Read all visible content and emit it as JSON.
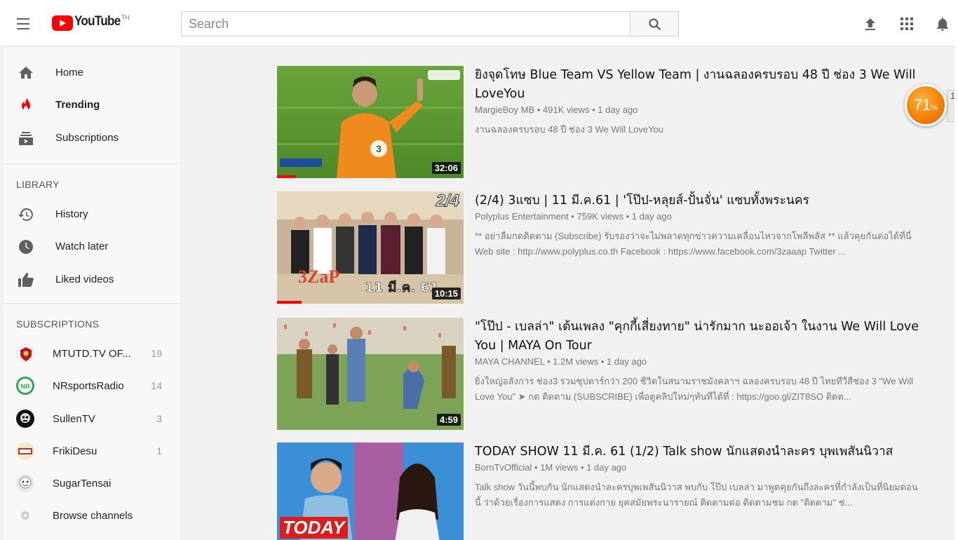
{
  "header": {
    "logo_text": "YouTube",
    "logo_country": "TH",
    "search_placeholder": "Search"
  },
  "sidebar": {
    "main": [
      {
        "label": "Home",
        "icon": "home-icon"
      },
      {
        "label": "Trending",
        "icon": "flame-icon",
        "active": true
      },
      {
        "label": "Subscriptions",
        "icon": "subscriptions-icon"
      }
    ],
    "library_title": "LIBRARY",
    "library": [
      {
        "label": "History",
        "icon": "history-icon"
      },
      {
        "label": "Watch later",
        "icon": "clock-icon"
      },
      {
        "label": "Liked videos",
        "icon": "thumbs-up-icon"
      }
    ],
    "subscriptions_title": "SUBSCRIPTIONS",
    "subscriptions": [
      {
        "name": "MTUTD.TV OF...",
        "count": "19"
      },
      {
        "name": "NRsportsRadio",
        "count": "14"
      },
      {
        "name": "SullenTV",
        "count": "3"
      },
      {
        "name": "FrikiDesu",
        "count": "1"
      },
      {
        "name": "SugarTensai",
        "count": ""
      },
      {
        "name": "Browse channels",
        "count": ""
      }
    ]
  },
  "videos": [
    {
      "title": "ยิงจุดโทษ Blue Team VS Yellow Team | งานฉลองครบรอบ 48 ปี ช่อง 3 We Will LoveYou",
      "channel": "MargieBoy MB",
      "views": "491K views",
      "age": "1 day ago",
      "description": "งานฉลองครบรอบ 48 ปี ช่อง 3 We Will LoveYou",
      "duration": "32:06",
      "watched_fraction": 0.1
    },
    {
      "title": "(2/4) 3แซบ | 11 มี.ค.61 | 'โป๊ป-หลุยส์-ปั้นจั่น' แซบทั้งพระนคร",
      "channel": "Polyplus Entertainment",
      "views": "759K views",
      "age": "1 day ago",
      "description": "** อย่าลืมกดติดตาม (Subscribe) รับรองว่าจะไม่พลาดทุกข่าวความเคลื่อนไหวจากโพลีพลัส ** แล้วคุยกันต่อได้ที่นี่ Web site : http://www.polyplus.co.th Facebook : https://www.facebook.com/3zaaap Twitter ...",
      "duration": "10:15",
      "thumb_text": "2/4",
      "thumb_date": "11 มี.ค. 61",
      "watched_fraction": 0.13
    },
    {
      "title": "\"โป๊ป - เบลล่า\" เต้นเพลง \"คุกกี้เสี่ยงทาย\" น่ารักมาก นะออเจ้า ในงาน We Will Love You | MAYA On Tour",
      "channel": "MAYA CHANNEL",
      "views": "1.2M views",
      "age": "1 day ago",
      "description": "ยิ่งใหญ่อลังการ ช่อง3 รวมซุปตาร์กว่า 200 ชีวิตในสนามราชมังคลาฯ ฉลองครบรอบ 48 ปี ไทยทีวีสีช่อง 3 \"We Will Love You\" ➤ กด ติดตาม (SUBSCRIBE) เพื่อดูคลิปใหม่ๆทันทีได้ที่ : https://goo.gl/ZIT8SO ติดต...",
      "duration": "4:59",
      "watched_fraction": 0
    },
    {
      "title": "TODAY SHOW 11 มี.ค. 61 (1/2) Talk show นักแสดงนำละคร บุพเพสันนิวาส",
      "channel": "BornTvOfficial",
      "views": "1M views",
      "age": "1 day ago",
      "description": "Talk show วันนี้พบกัน นักแสดงนำละครบุพเพสันนิวาส พบกับ โป๊ป เบลล่า มาพูดคุยกันถึงละครที่กำลังเป็นที่นิยมตอนนี้ ว่าด้วยเรื่องการแสดง การแต่งกาย ยุคสมัยพระนารายณ์ ติดตามต่อ ติดตามชม กด \"ติดตาม\" ช่...",
      "duration": "",
      "thumb_text": "TODAY",
      "watched_fraction": 0
    }
  ],
  "overlay": {
    "badge_value": "71",
    "badge_unit": "%",
    "edge_text": "1"
  },
  "colors": {
    "brand_red": "#ff0000",
    "badge_orange": "#f07a00"
  }
}
